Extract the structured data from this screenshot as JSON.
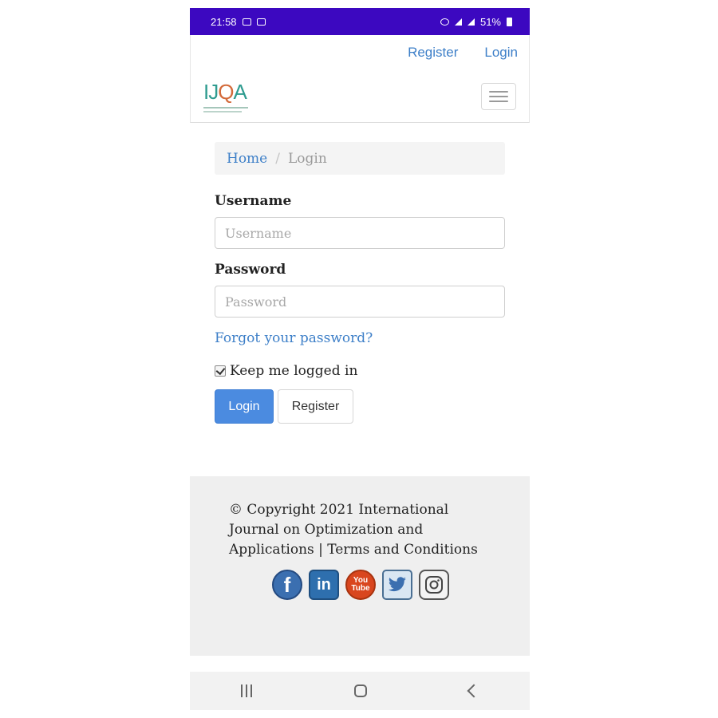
{
  "status_bar": {
    "time": "21:58",
    "battery": "51%"
  },
  "header": {
    "register_link": "Register",
    "login_link": "Login",
    "logo_text": "IJOA",
    "menu_icon": "hamburger-icon"
  },
  "breadcrumb": {
    "home": "Home",
    "separator": "/",
    "current": "Login"
  },
  "form": {
    "username_label": "Username",
    "username_placeholder": "Username",
    "password_label": "Password",
    "password_placeholder": "Password",
    "forgot_link": "Forgot your password?",
    "keep_logged_in": "Keep me logged in",
    "keep_logged_in_checked": true,
    "login_button": "Login",
    "register_button": "Register"
  },
  "footer": {
    "copyright": "© Copyright 2021 International Journal on Optimization and Applications | Terms and Conditions",
    "social": [
      "facebook-icon",
      "linkedin-icon",
      "youtube-icon",
      "twitter-icon",
      "instagram-icon"
    ]
  },
  "colors": {
    "status_bar": "#3c08c0",
    "link": "#3d7fc8",
    "primary_button": "#4b8be0",
    "footer_bg": "#efefef"
  }
}
